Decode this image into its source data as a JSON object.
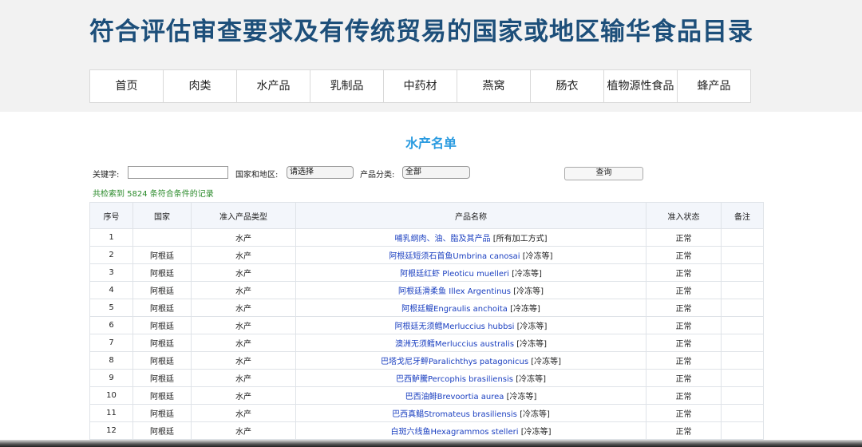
{
  "site": {
    "title": "符合评估审查要求及有传统贸易的国家或地区输华食品目录"
  },
  "nav": [
    "首页",
    "肉类",
    "水产品",
    "乳制品",
    "中药材",
    "燕窝",
    "肠衣",
    "植物源性食品",
    "蜂产品"
  ],
  "page": {
    "heading": "水产名单"
  },
  "filters": {
    "keyword_label": "关键字:",
    "keyword_value": "",
    "country_label": "国家和地区:",
    "country_value": "请选择",
    "category_label": "产品分类:",
    "category_value": "全部",
    "query_button": "查询"
  },
  "result_count": "共检索到 5824 条符合条件的记录",
  "table": {
    "columns": [
      "序号",
      "国家",
      "准入产品类型",
      "产品名称",
      "准入状态",
      "备注"
    ],
    "rows": [
      {
        "no": "1",
        "country": "",
        "type": "水产",
        "name": "哺乳纲肉、油、脂及其产品",
        "tag": "[所有加工方式]",
        "status": "正常",
        "note": ""
      },
      {
        "no": "2",
        "country": "阿根廷",
        "type": "水产",
        "name": "阿根廷短须石首鱼Umbrina canosai",
        "tag": "[冷冻等]",
        "status": "正常",
        "note": ""
      },
      {
        "no": "3",
        "country": "阿根廷",
        "type": "水产",
        "name": "阿根廷红虾 Pleoticu muelleri",
        "tag": "[冷冻等]",
        "status": "正常",
        "note": ""
      },
      {
        "no": "4",
        "country": "阿根廷",
        "type": "水产",
        "name": "阿根廷滑柔鱼 Illex Argentinus",
        "tag": "[冷冻等]",
        "status": "正常",
        "note": ""
      },
      {
        "no": "5",
        "country": "阿根廷",
        "type": "水产",
        "name": "阿根廷鳀Engraulis anchoita",
        "tag": "[冷冻等]",
        "status": "正常",
        "note": ""
      },
      {
        "no": "6",
        "country": "阿根廷",
        "type": "水产",
        "name": "阿根廷无须鳕Merluccius hubbsi",
        "tag": "[冷冻等]",
        "status": "正常",
        "note": ""
      },
      {
        "no": "7",
        "country": "阿根廷",
        "type": "水产",
        "name": "澳洲无须鳕Merluccius australis",
        "tag": "[冷冻等]",
        "status": "正常",
        "note": ""
      },
      {
        "no": "8",
        "country": "阿根廷",
        "type": "水产",
        "name": "巴塔戈尼牙鲆Paralichthys patagonicus",
        "tag": "[冷冻等]",
        "status": "正常",
        "note": ""
      },
      {
        "no": "9",
        "country": "阿根廷",
        "type": "水产",
        "name": "巴西鲈騰Percophis brasiliensis",
        "tag": "[冷冻等]",
        "status": "正常",
        "note": ""
      },
      {
        "no": "10",
        "country": "阿根廷",
        "type": "水产",
        "name": "巴西油鲱Brevoortia aurea",
        "tag": "[冷冻等]",
        "status": "正常",
        "note": ""
      },
      {
        "no": "11",
        "country": "阿根廷",
        "type": "水产",
        "name": "巴西真鲳Stromateus brasiliensis",
        "tag": "[冷冻等]",
        "status": "正常",
        "note": ""
      },
      {
        "no": "12",
        "country": "阿根廷",
        "type": "水产",
        "name": "白斑六线鱼Hexagrammos stelleri",
        "tag": "[冷冻等]",
        "status": "正常",
        "note": ""
      }
    ]
  }
}
